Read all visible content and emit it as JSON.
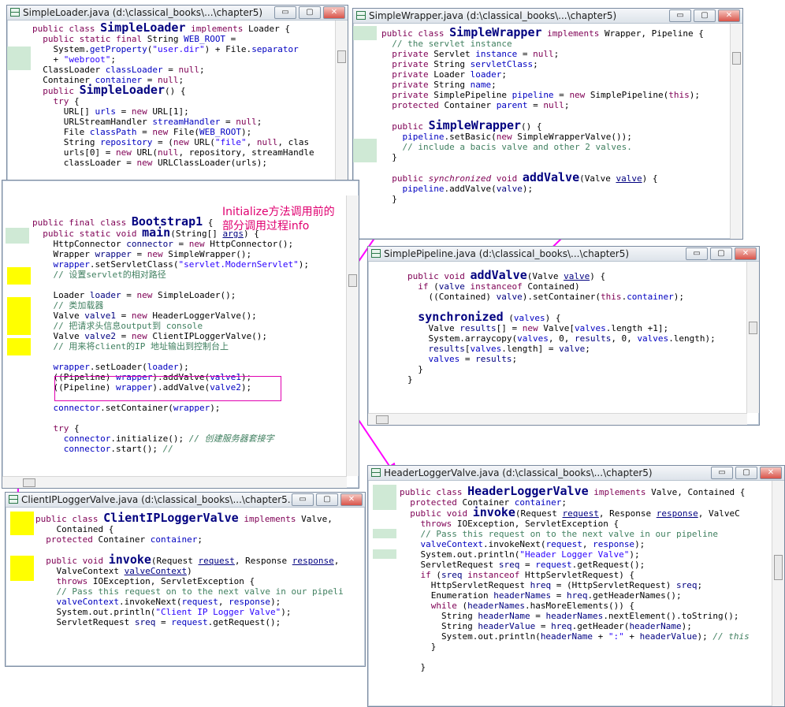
{
  "windows": {
    "simple_loader": {
      "title": "SimpleLoader.java (d:\\classical_books\\...\\chapter5)"
    },
    "simple_wrapper": {
      "title": "SimpleWrapper.java (d:\\classical_books\\...\\chapter5)"
    },
    "simple_pipeline": {
      "title": "SimplePipeline.java (d:\\classical_books\\...\\chapter5)"
    },
    "bootstrap": {
      "title": ""
    },
    "client_ip": {
      "title": "ClientIPLoggerValve.java (d:\\classical_books\\...\\chapter5..."
    },
    "header_logger": {
      "title": "HeaderLoggerValve.java (d:\\classical_books\\...\\chapter5)"
    }
  },
  "window_buttons": {
    "minimize": "▭",
    "maximize": "▢",
    "close": "✕",
    "scroll_marks": "|||"
  },
  "annotation": {
    "line1": "Initialize方法调用前的",
    "line2": "部分调用过程info"
  },
  "colors": {
    "arrow": "#ff00ff",
    "annotation": "#e00070",
    "highlight": "#ffff00",
    "gutter": "#cfe9d5"
  }
}
